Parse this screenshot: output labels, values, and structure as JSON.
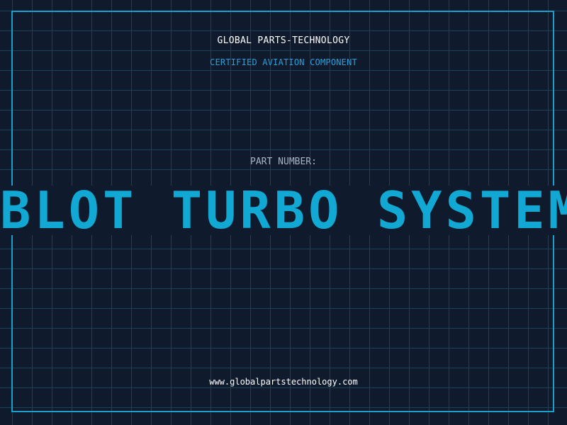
{
  "header": {
    "company": "GLOBAL PARTS-TECHNOLOGY",
    "subtitle": "CERTIFIED AVIATION COMPONENT"
  },
  "part": {
    "label": "PART NUMBER:",
    "marquee_text": "BLOT TURBO SYSTEM B"
  },
  "footer": {
    "website": "www.globalpartstechnology.com"
  },
  "colors": {
    "background": "#0f1a2d",
    "grid": "#17435a",
    "accent": "#11a9d4",
    "frame": "#1aa0cc"
  }
}
